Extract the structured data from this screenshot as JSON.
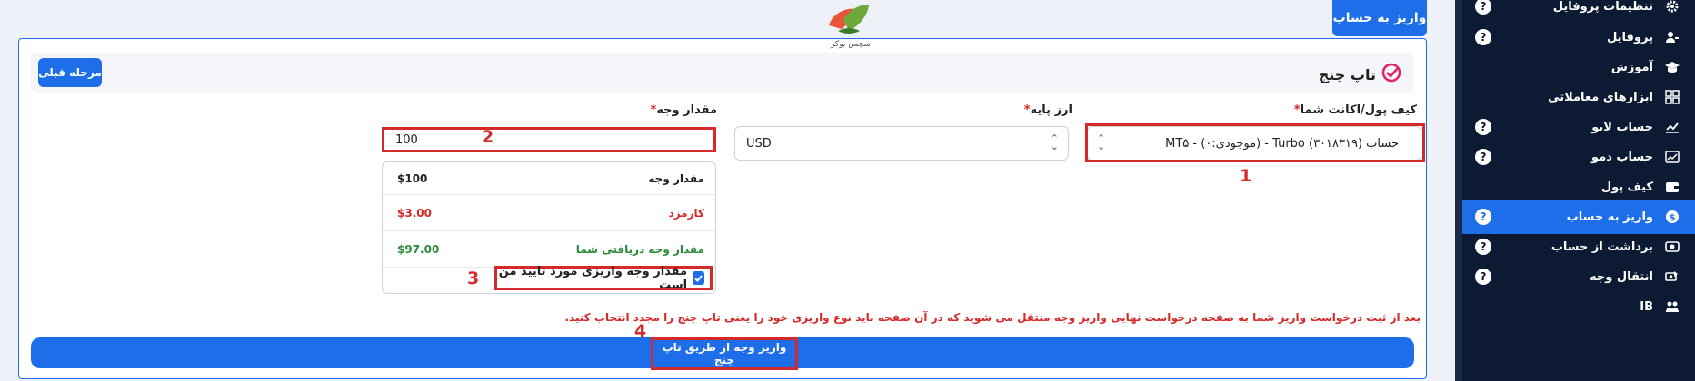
{
  "sidebar": {
    "items": [
      {
        "label": "تنظیمات پروفایل",
        "icon": "gear-icon",
        "help": "?"
      },
      {
        "label": "پروفایل",
        "icon": "user-icon",
        "help": "?"
      },
      {
        "label": "آموزش",
        "icon": "graduation-cap-icon",
        "help": ""
      },
      {
        "label": "ابزارهای معاملاتی",
        "icon": "calculator-icon",
        "help": ""
      },
      {
        "label": "حساب لایو",
        "icon": "live-chart-icon",
        "help": "?"
      },
      {
        "label": "حساب دمو",
        "icon": "demo-chart-icon",
        "help": "?"
      },
      {
        "label": "کیف پول",
        "icon": "wallet-icon",
        "help": ""
      },
      {
        "label": "واریز به حساب",
        "icon": "deposit-coin-icon",
        "help": "?",
        "active": true
      },
      {
        "label": "برداشت از حساب",
        "icon": "withdraw-icon",
        "help": "?"
      },
      {
        "label": "انتقال وجه",
        "icon": "transfer-icon",
        "help": "?"
      },
      {
        "label": "IB",
        "icon": "ib-icon",
        "help": ""
      }
    ]
  },
  "tab": {
    "label": "واریز به حساب"
  },
  "logo": {
    "text": "سچس بوکر"
  },
  "header": {
    "title": "تاپ چنج",
    "prev_button": "مرحله قبلی"
  },
  "form": {
    "wallet_label": "کیف پول/اکانت شما",
    "wallet_value": "حساب Turbo (۳۰۱۸۳۱۹) - (موجودی:۰) - MT۵",
    "base_label": "ارز پایه",
    "base_value": "USD",
    "amount_label": "مقدار وجه",
    "amount_value": "100",
    "required_mark": "*"
  },
  "summary": {
    "rows": [
      {
        "label": "مقدار وجه",
        "value": "$100"
      },
      {
        "label": "کارمزد",
        "value": "$3.00"
      },
      {
        "label": "مقدار وجه دریافتی شما",
        "value": "$97.00"
      }
    ]
  },
  "confirm": {
    "label": "مقدار وجه واریزی مورد تایید من است",
    "checked": true
  },
  "notice": "بعد از ثبت درخواست واریز شما به صفحه درخواست نهایی واریز وجه منتقل می شوید که در آن صفحه باید نوع واریزی خود را یعنی تاپ چنج را مجدد انتخاب کنید.",
  "submit": {
    "label": "واریز وجه از طریق تاپ چنج"
  },
  "annotations": {
    "n1": "1",
    "n2": "2",
    "n3": "3",
    "n4": "4"
  },
  "colors": {
    "primary": "#1d6ee8",
    "sidebar": "#0c1a33",
    "annotation": "#d42a2a",
    "fee": "#d42a2a",
    "received": "#2a8a3a"
  }
}
